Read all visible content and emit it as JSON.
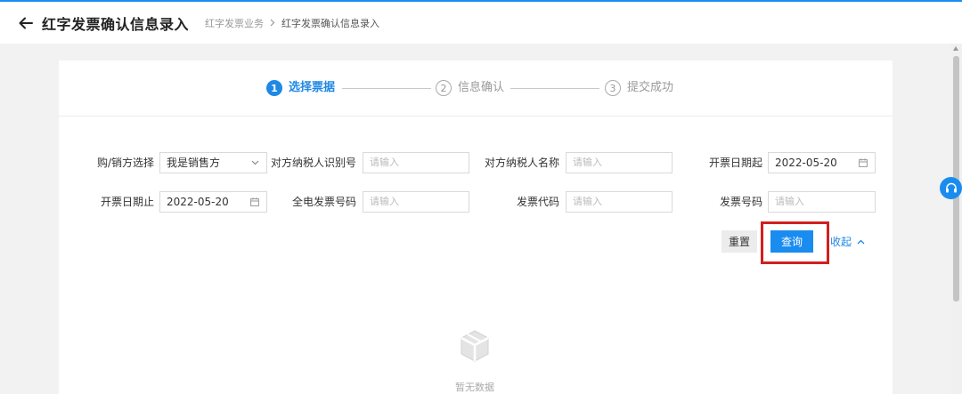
{
  "header": {
    "title": "红字发票确认信息录入",
    "breadcrumb": [
      "红字发票业务",
      "红字发票确认信息录入"
    ]
  },
  "steps": [
    {
      "num": "1",
      "label": "选择票据",
      "active": true
    },
    {
      "num": "2",
      "label": "信息确认",
      "active": false
    },
    {
      "num": "3",
      "label": "提交成功",
      "active": false
    }
  ],
  "form": {
    "party_label": "购/销方选择",
    "party_value": "我是销售方",
    "tax_id_label": "对方纳税人识别号",
    "tax_id_placeholder": "请输入",
    "taxpayer_name_label": "对方纳税人名称",
    "taxpayer_name_placeholder": "请输入",
    "start_date_label": "开票日期起",
    "start_date_value": "2022-05-20",
    "end_date_label": "开票日期止",
    "end_date_value": "2022-05-20",
    "einvoice_no_label": "全电发票号码",
    "einvoice_no_placeholder": "请输入",
    "invoice_code_label": "发票代码",
    "invoice_code_placeholder": "请输入",
    "invoice_no_label": "发票号码",
    "invoice_no_placeholder": "请输入"
  },
  "actions": {
    "reset": "重置",
    "query": "查询",
    "collapse": "收起"
  },
  "empty": {
    "text": "暂无数据"
  },
  "colors": {
    "accent": "#1a8cf0",
    "highlight": "#d11f1f"
  }
}
